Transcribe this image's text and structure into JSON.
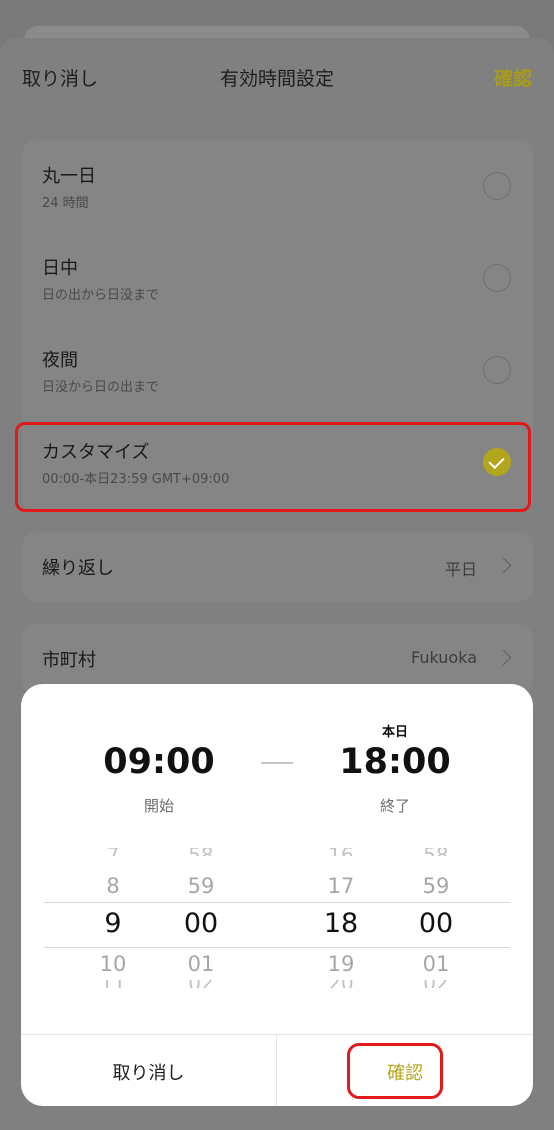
{
  "header": {
    "cancel_label": "取り消し",
    "title": "有効時間設定",
    "confirm_label": "確認"
  },
  "options": [
    {
      "label": "丸一日",
      "sub": "24 時間",
      "selected": false
    },
    {
      "label": "日中",
      "sub": "日の出から日没まで",
      "selected": false
    },
    {
      "label": "夜間",
      "sub": "日没から日の出まで",
      "selected": false
    },
    {
      "label": "カスタマイズ",
      "sub": "00:00-本日23:59 GMT+09:00",
      "selected": true
    }
  ],
  "repeat": {
    "label": "繰り返し",
    "value": "平日"
  },
  "city": {
    "label": "市町村",
    "value": "Fukuoka"
  },
  "picker": {
    "start_time": "09:00",
    "start_label": "開始",
    "end_day": "本日",
    "end_time": "18:00",
    "end_label": "終了",
    "wheels": [
      {
        "prev": "8",
        "selected": "9",
        "next": "10"
      },
      {
        "prev": "59",
        "selected": "00",
        "next": "01"
      },
      {
        "prev": "17",
        "selected": "18",
        "next": "19"
      },
      {
        "prev": "59",
        "selected": "00",
        "next": "01"
      }
    ],
    "cancel_label": "取り消し",
    "confirm_label": "確認"
  },
  "colors": {
    "accent": "#b3a51c",
    "highlight_border": "#e01a1a",
    "overlay": "#808080"
  }
}
